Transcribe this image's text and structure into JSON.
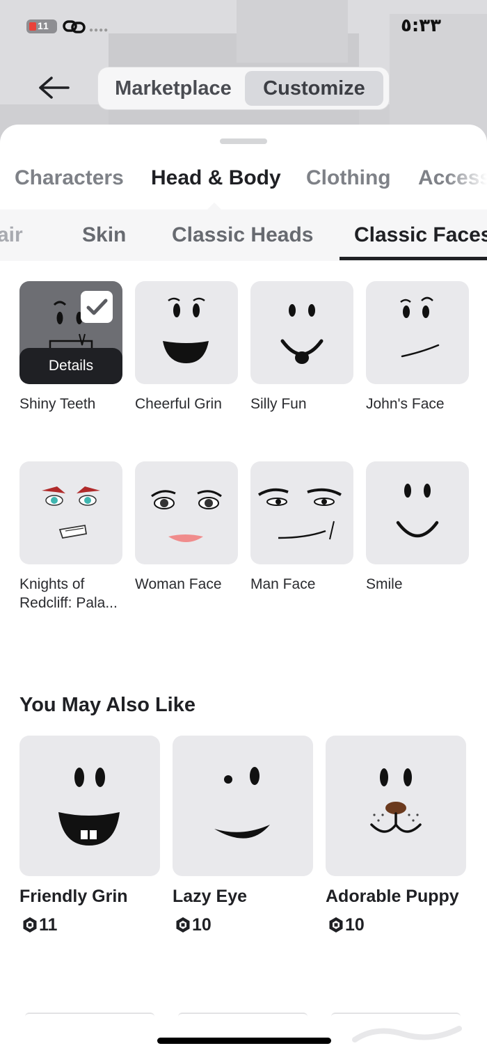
{
  "status_bar": {
    "battery_text": "11",
    "time": "٥:٣٣"
  },
  "header": {
    "back_icon": "arrow-left-icon",
    "segments": [
      {
        "label": "Marketplace",
        "selected": false
      },
      {
        "label": "Customize",
        "selected": true
      }
    ]
  },
  "category_tabs": [
    {
      "label": "Characters",
      "active": false
    },
    {
      "label": "Head & Body",
      "active": true
    },
    {
      "label": "Clothing",
      "active": false
    },
    {
      "label": "Access",
      "active": false
    }
  ],
  "sub_tabs": [
    {
      "label": "air",
      "active": false
    },
    {
      "label": "Skin",
      "active": false
    },
    {
      "label": "Classic Heads",
      "active": false
    },
    {
      "label": "Classic Faces",
      "active": true
    }
  ],
  "faces": [
    {
      "name": "Shiny Teeth",
      "selected": true,
      "overlay_label": "Details",
      "icon": "shiny-teeth-face-icon"
    },
    {
      "name": "Cheerful Grin",
      "selected": false,
      "icon": "cheerful-grin-face-icon"
    },
    {
      "name": "Silly Fun",
      "selected": false,
      "icon": "silly-fun-face-icon"
    },
    {
      "name": "John's Face",
      "selected": false,
      "icon": "johns-face-icon"
    },
    {
      "name": "Knights of Redcliff: Pala...",
      "selected": false,
      "icon": "knights-face-icon"
    },
    {
      "name": "Woman Face",
      "selected": false,
      "icon": "woman-face-icon"
    },
    {
      "name": "Man Face",
      "selected": false,
      "icon": "man-face-icon"
    },
    {
      "name": "Smile",
      "selected": false,
      "icon": "smile-face-icon"
    }
  ],
  "recommendations": {
    "title": "You May Also Like",
    "items": [
      {
        "name": "Friendly Grin",
        "price": "11",
        "icon": "friendly-grin-face-icon"
      },
      {
        "name": "Lazy Eye",
        "price": "10",
        "icon": "lazy-eye-face-icon"
      },
      {
        "name": "Adorable Puppy",
        "price": "10",
        "icon": "adorable-puppy-face-icon"
      }
    ]
  },
  "colors": {
    "accent_dark": "#1f2024",
    "tile_bg": "#e9e9ec",
    "battery_red": "#e8423a"
  }
}
